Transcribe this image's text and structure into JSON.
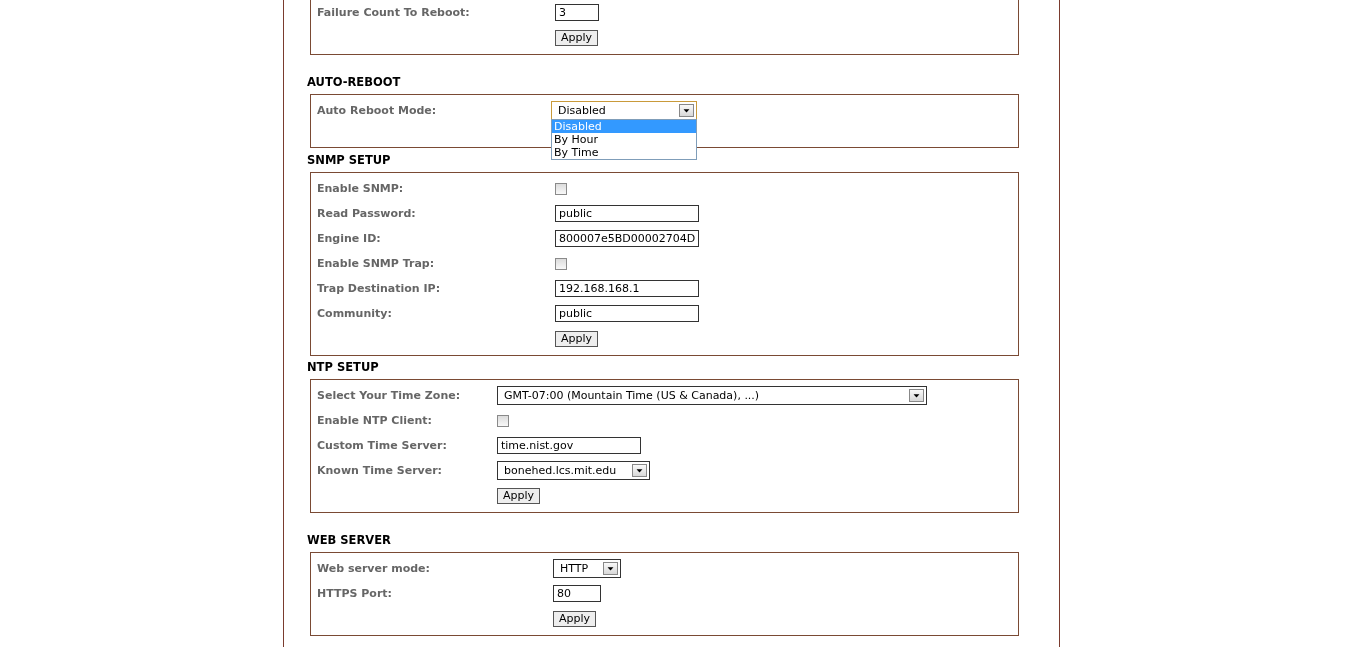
{
  "sections": [
    {
      "rows": [
        {
          "kind": "text",
          "label": "Failure Count To Reboot:",
          "value": "3"
        },
        {
          "kind": "button",
          "label": "Apply"
        }
      ]
    },
    {
      "heading": "AUTO-REBOOT",
      "rows": [
        {
          "kind": "select",
          "label": "Auto Reboot Mode:",
          "value": "Disabled",
          "expanded": true,
          "options": [
            {
              "label": "Disabled",
              "selected": true
            },
            {
              "label": "By Hour",
              "selected": false
            },
            {
              "label": "By Time",
              "selected": false
            }
          ]
        }
      ]
    },
    {
      "heading": "SNMP SETUP",
      "rows": [
        {
          "kind": "checkbox",
          "label": "Enable SNMP:",
          "checked": false
        },
        {
          "kind": "text",
          "label": "Read Password:",
          "value": "public"
        },
        {
          "kind": "text",
          "label": "Engine ID:",
          "value": "800007e5BD00002704D"
        },
        {
          "kind": "checkbox",
          "label": "Enable SNMP Trap:",
          "checked": false
        },
        {
          "kind": "text",
          "label": "Trap Destination IP:",
          "value": "192.168.168.1"
        },
        {
          "kind": "text",
          "label": "Community:",
          "value": "public"
        },
        {
          "kind": "button",
          "label": "Apply"
        }
      ]
    },
    {
      "heading": "NTP SETUP",
      "rows": [
        {
          "kind": "select",
          "label": "Select Your Time Zone:",
          "value": "GMT-07:00 (Mountain Time (US & Canada), ...)",
          "expanded": false
        },
        {
          "kind": "checkbox",
          "label": "Enable NTP Client:",
          "checked": false
        },
        {
          "kind": "text",
          "label": "Custom Time Server:",
          "value": "time.nist.gov"
        },
        {
          "kind": "select",
          "label": "Known Time Server:",
          "value": "bonehed.lcs.mit.edu",
          "expanded": false
        },
        {
          "kind": "button",
          "label": "Apply"
        }
      ]
    },
    {
      "heading": "WEB SERVER",
      "rows": [
        {
          "kind": "select",
          "label": "Web server mode:",
          "value": "HTTP",
          "expanded": false
        },
        {
          "kind": "text",
          "label": "HTTPS Port:",
          "value": "80"
        },
        {
          "kind": "button",
          "label": "Apply"
        }
      ]
    }
  ]
}
